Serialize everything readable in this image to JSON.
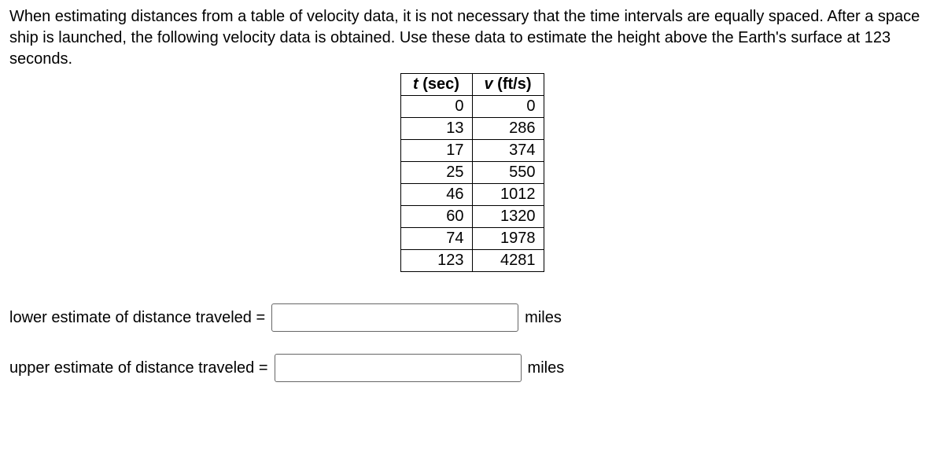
{
  "prompt": "When estimating distances from a table of velocity data, it is not necessary that the time intervals are equally spaced. After a space ship is launched, the following velocity data is obtained. Use these data to estimate the height above the Earth's surface at 123 seconds.",
  "table": {
    "headers": {
      "t": "t",
      "t_unit": " (sec)",
      "v": "v",
      "v_unit": " (ft/s)"
    },
    "rows": [
      {
        "t": "0",
        "v": "0"
      },
      {
        "t": "13",
        "v": "286"
      },
      {
        "t": "17",
        "v": "374"
      },
      {
        "t": "25",
        "v": "550"
      },
      {
        "t": "46",
        "v": "1012"
      },
      {
        "t": "60",
        "v": "1320"
      },
      {
        "t": "74",
        "v": "1978"
      },
      {
        "t": "123",
        "v": "4281"
      }
    ]
  },
  "answers": {
    "lower_label": "lower estimate of distance traveled =",
    "upper_label": "upper estimate of distance traveled =",
    "unit": "miles",
    "lower_value": "",
    "upper_value": ""
  }
}
